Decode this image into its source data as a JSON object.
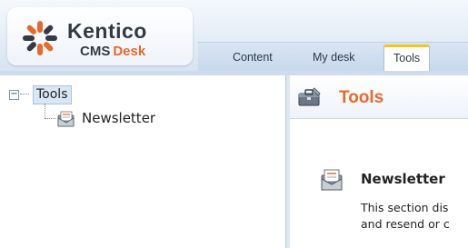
{
  "logo": {
    "name": "Kentico",
    "product_cms": "CMS",
    "product_desk": "Desk"
  },
  "tabs": [
    {
      "label": "Content",
      "selected": false
    },
    {
      "label": "My desk",
      "selected": false
    },
    {
      "label": "Tools",
      "selected": true
    }
  ],
  "tree": {
    "expander": "−",
    "root": {
      "label": "Tools",
      "selected": true
    },
    "children": [
      {
        "label": "Newsletter",
        "icon": "newsletter-icon"
      }
    ]
  },
  "content": {
    "title": "Tools",
    "title_icon": "toolbox-icon",
    "section": {
      "title": "Newsletter",
      "icon": "newsletter-icon",
      "description_line1": "This section dis",
      "description_line2": "and resend or c"
    }
  },
  "colors": {
    "accent_orange": "#e8692d",
    "tab_highlight": "#f5c518",
    "header_blue": "#d7e3f1"
  }
}
